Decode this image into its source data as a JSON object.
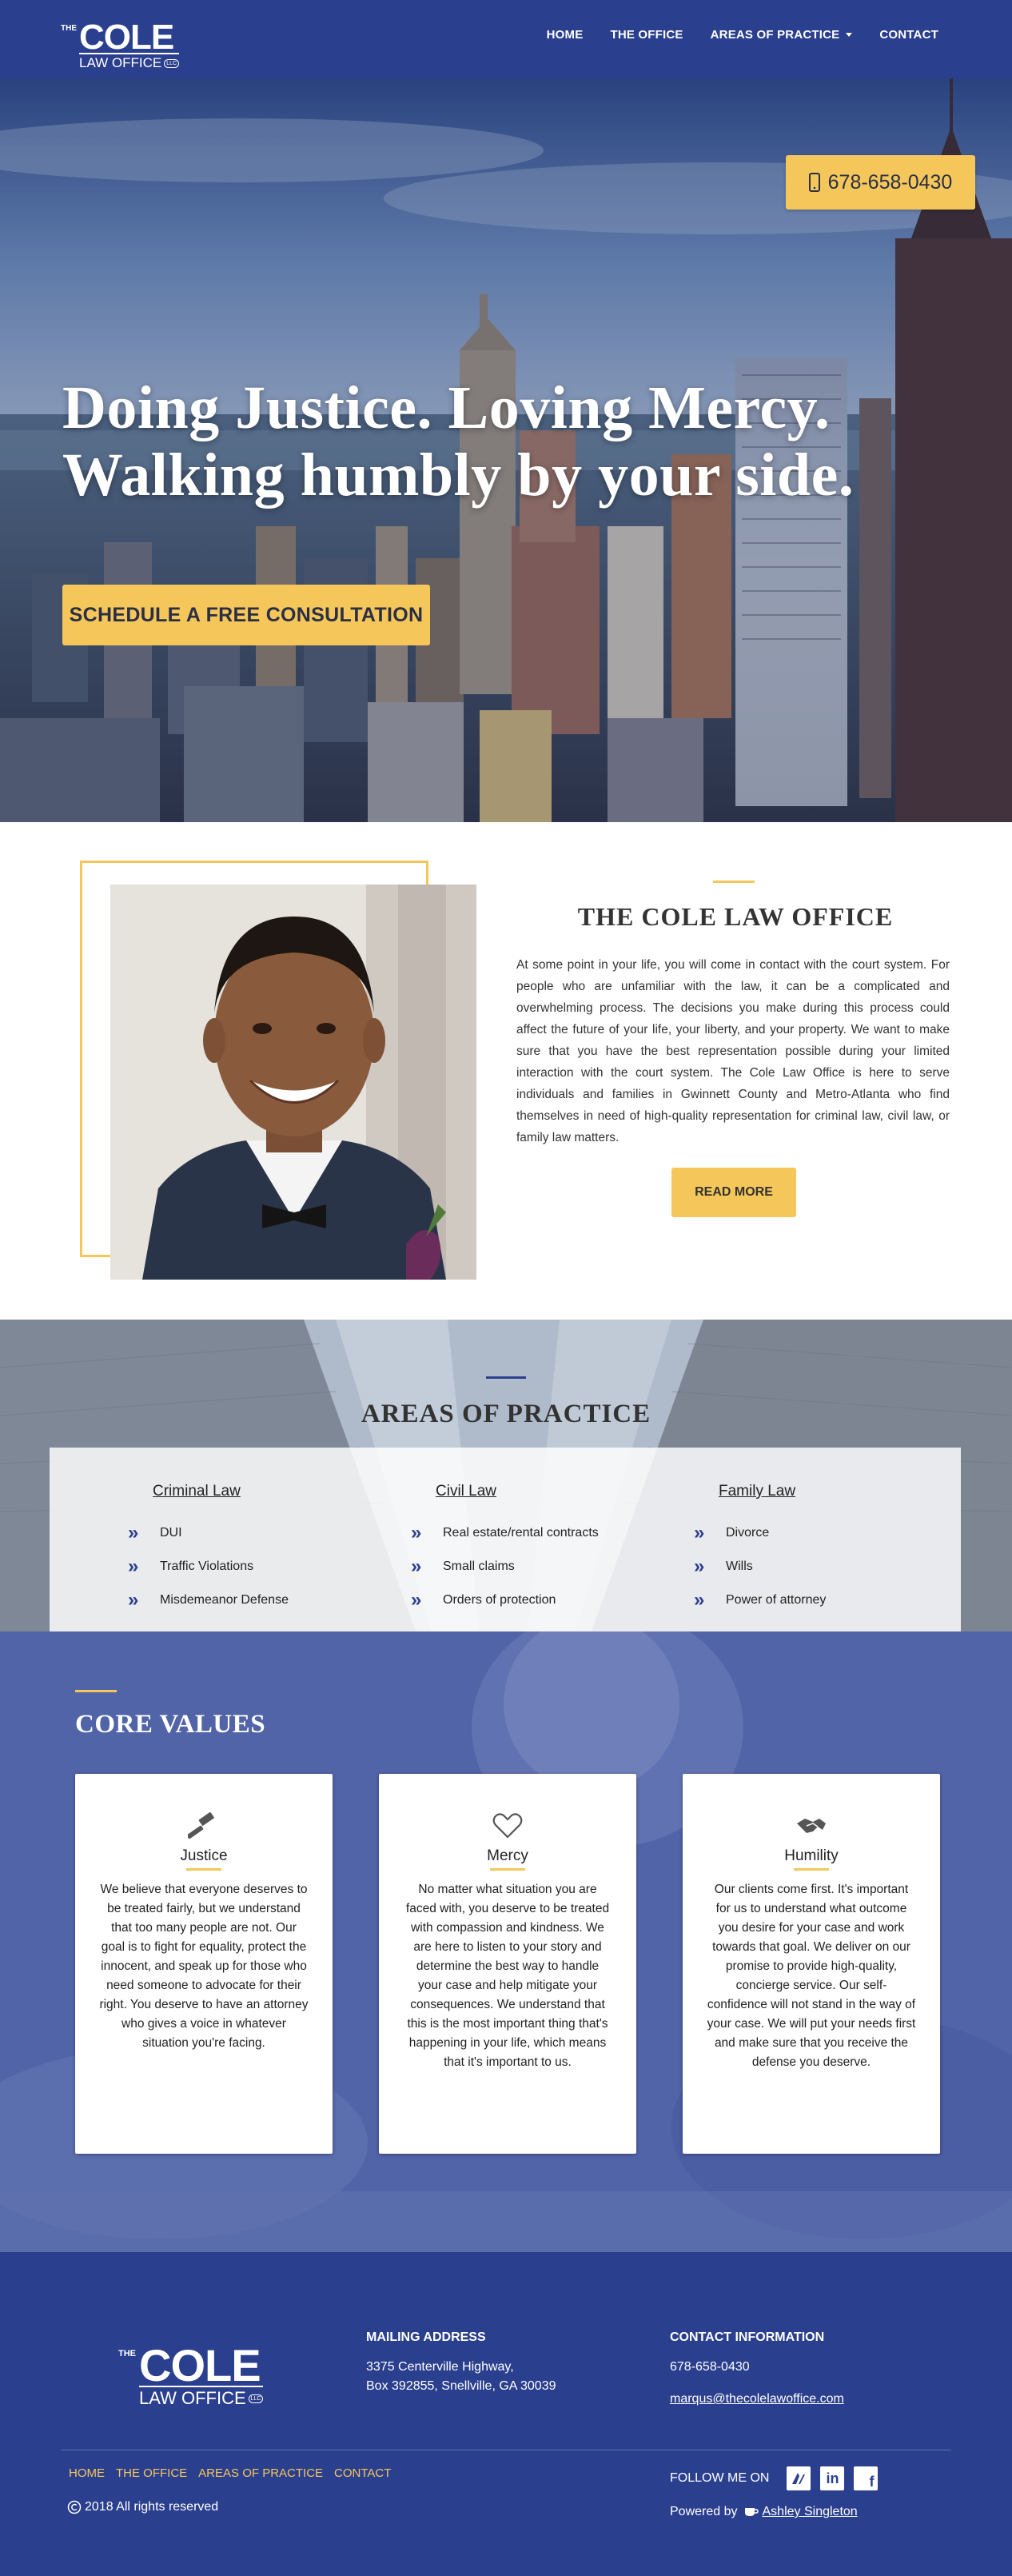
{
  "nav": {
    "logo": {
      "the": "THE",
      "cole": "COLE",
      "law_office": "LAW OFFICE",
      "llc": "LLC"
    },
    "items": [
      {
        "label": "HOME"
      },
      {
        "label": "THE OFFICE"
      },
      {
        "label": "AREAS OF PRACTICE"
      },
      {
        "label": "CONTACT"
      }
    ],
    "phone": "678-658-0430"
  },
  "hero": {
    "line1": "Doing Justice. Loving Mercy.",
    "line2": "Walking humbly by your side.",
    "cta": "SCHEDULE A FREE CONSULTATION"
  },
  "about": {
    "title": "THE COLE LAW OFFICE",
    "body": "At some point in your life, you will come in contact with the court system. For people who are unfamiliar with the law, it can be a complicated and overwhelming process. The decisions you make during this process could affect the future of your life, your liberty, and your property. We want to make sure that you have the best representation possible during your limited interaction with the court system. The Cole Law Office is here to serve individuals and families in Gwinnett County and Metro-Atlanta who find themselves in need of high-quality representation for criminal law, civil law, or family law matters.",
    "button": "READ MORE"
  },
  "practice": {
    "title": "AREAS OF PRACTICE",
    "columns": [
      {
        "heading": "Criminal Law",
        "items": [
          "DUI",
          "Traffic Violations",
          "Misdemeanor Defense"
        ]
      },
      {
        "heading": "Civil Law",
        "items": [
          "Real estate/rental contracts",
          "Small claims",
          "Orders of protection"
        ]
      },
      {
        "heading": "Family Law",
        "items": [
          "Divorce",
          "Wills",
          "Power of attorney"
        ]
      }
    ]
  },
  "values": {
    "title": "CORE VALUES",
    "cards": [
      {
        "icon": "gavel-icon",
        "title": "Justice",
        "text": "We believe that everyone deserves to be treated fairly, but we understand that too many people are not. Our goal is to fight for equality, protect the innocent, and speak up for those who need someone to advocate for their right. You deserve to have an attorney who gives a voice in whatever situation you're facing."
      },
      {
        "icon": "heart-icon",
        "title": "Mercy",
        "text": "No matter what situation you are faced with, you deserve to be treated with compassion and kindness. We are here to listen to your story and determine the best way to handle your case and help mitigate your consequences. We understand that this is the most important thing that's happening in your life, which means that it's important to us."
      },
      {
        "icon": "handshake-icon",
        "title": "Humility",
        "text": "Our clients come first. It's important for us to understand what outcome you desire for your case and work towards that goal. We deliver on our promise to provide high-quality, concierge service. Our self-confidence will not stand in the way of your case. We will put your needs first and make sure that you receive the defense you deserve."
      }
    ]
  },
  "footer": {
    "mailing_heading": "MAILING ADDRESS",
    "address_line1": "3375 Centerville Highway,",
    "address_line2": "Box 392855, Snellville, GA 30039",
    "contact_heading": "CONTACT INFORMATION",
    "phone": "678-658-0430",
    "email": "marqus@thecolelawoffice.com",
    "links": [
      "HOME",
      "THE OFFICE",
      "AREAS OF PRACTICE",
      "CONTACT"
    ],
    "copyright": "2018 All rights reserved",
    "follow": "FOLLOW ME ON",
    "powered_by": "Powered by",
    "powered_name": "Ashley Singleton"
  },
  "colors": {
    "brand_blue": "#2b3f8f",
    "accent_gold": "#f5c75a"
  }
}
